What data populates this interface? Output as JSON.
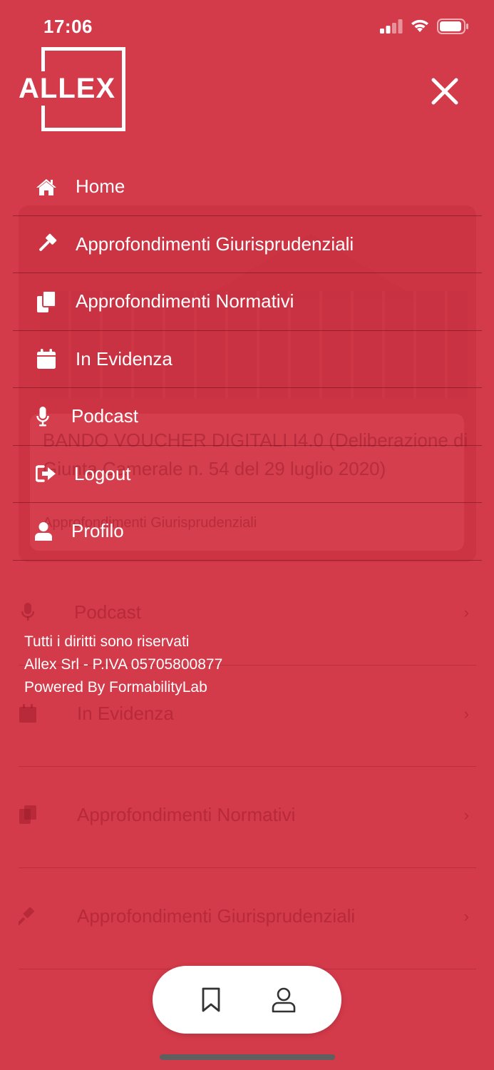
{
  "status": {
    "time": "17:06"
  },
  "logo": {
    "text": "ALLEX"
  },
  "menu": {
    "items": [
      {
        "label": "Home",
        "icon": "home-icon"
      },
      {
        "label": "Approfondimenti Giurisprudenziali",
        "icon": "gavel-icon"
      },
      {
        "label": "Approfondimenti Normativi",
        "icon": "documents-icon"
      },
      {
        "label": "In Evidenza",
        "icon": "calendar-icon"
      },
      {
        "label": "Podcast",
        "icon": "microphone-icon"
      },
      {
        "label": "Logout",
        "icon": "logout-icon"
      },
      {
        "label": "Profilo",
        "icon": "user-icon"
      }
    ]
  },
  "footer": {
    "line1": "Tutti i diritti sono riservati",
    "line2": "Allex Srl - P.IVA 05705800877",
    "line3": "Powered By FormabilityLab"
  },
  "background": {
    "card_title": "BANDO VOUCHER DIGITALI I4.0 (Deliberazione di Giunta Camerale n. 54 del 29 luglio 2020)",
    "card_category": "Approfondimenti Giurisprudenziali",
    "rows": [
      "Podcast",
      "In Evidenza",
      "Approfondimenti Normativi",
      "Approfondimenti Giurisprudenziali"
    ]
  },
  "colors": {
    "accent": "#d33a4a",
    "foreground": "#ffffff"
  },
  "tabbar": {
    "icons": [
      "bookmark-icon",
      "profile-icon"
    ]
  }
}
